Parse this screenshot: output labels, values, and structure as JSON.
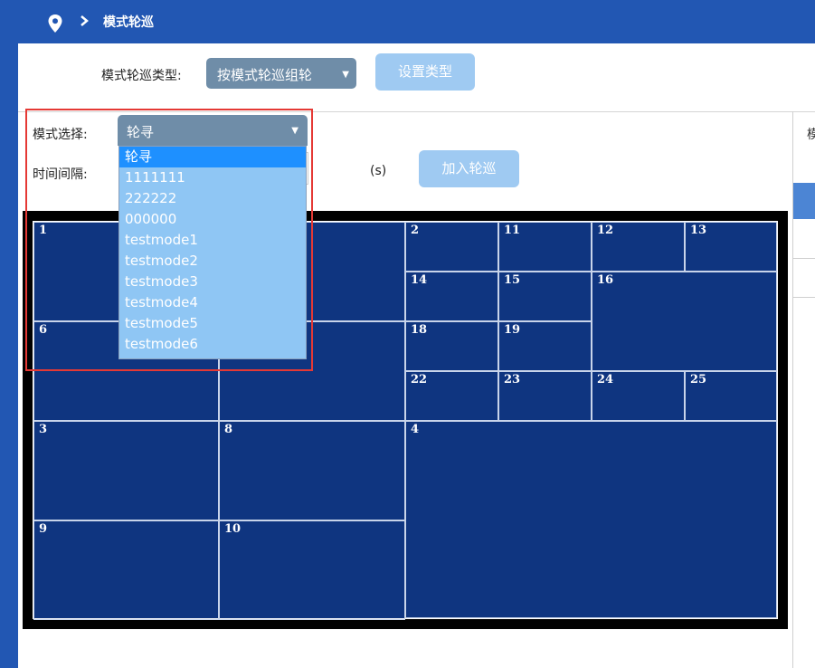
{
  "breadcrumb": {
    "title": "模式轮巡"
  },
  "top_form": {
    "type_label": "模式轮巡类型:",
    "type_value": "按模式轮巡组轮",
    "set_type_button": "设置类型"
  },
  "mode_form": {
    "mode_label": "模式选择:",
    "mode_value": "轮寻",
    "interval_label": "时间间隔:",
    "interval_unit": "(s)",
    "add_button": "加入轮巡"
  },
  "dropdown": {
    "options": [
      "轮寻",
      "1111111",
      "222222",
      "000000",
      "testmode1",
      "testmode2",
      "testmode3",
      "testmode4",
      "testmode5",
      "testmode6"
    ],
    "selected_index": 0
  },
  "right_panel": {
    "partial_label": "模"
  },
  "video_wall": {
    "cells": [
      "1",
      "6",
      "3",
      "8",
      "9",
      "10",
      "2",
      "11",
      "12",
      "13",
      "14",
      "15",
      "16",
      "18",
      "19",
      "22",
      "23",
      "24",
      "25",
      "4"
    ]
  },
  "colors": {
    "header": "#2257b3",
    "grid_bg": "#0f3580",
    "dropdown_bg": "#8fc6f4",
    "selected_option": "#1e90ff",
    "highlight": "#e53935"
  }
}
